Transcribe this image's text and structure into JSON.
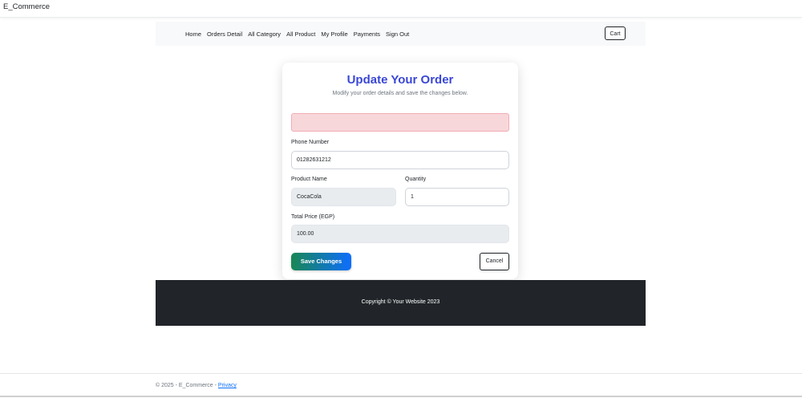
{
  "app": {
    "brand": "E_Commerce"
  },
  "nav": {
    "links": [
      "Home",
      "Orders Detail",
      "All Category",
      "All Product",
      "My Profile",
      "Payments",
      "Sign Out"
    ],
    "cart_label": "Cart"
  },
  "form": {
    "title": "Update Your Order",
    "subtitle": "Modify your order details and save the changes below.",
    "phone": {
      "label": "Phone Number",
      "value": "01282631212"
    },
    "product": {
      "label": "Product Name",
      "value": "CocaCola"
    },
    "quantity": {
      "label": "Quantity",
      "value": "1"
    },
    "total": {
      "label": "Total Price (EGP)",
      "value": "100.00"
    },
    "save_label": "Save Changes",
    "cancel_label": "Cancel"
  },
  "dark_footer": {
    "text": "Copyright © Your Website 2023"
  },
  "footer": {
    "text": "© 2025 - E_Commerce - ",
    "privacy_label": "Privacy"
  },
  "colors": {
    "title": "#3a47d5",
    "alert_bg": "#f8d7da",
    "dark_footer": "#212529"
  }
}
